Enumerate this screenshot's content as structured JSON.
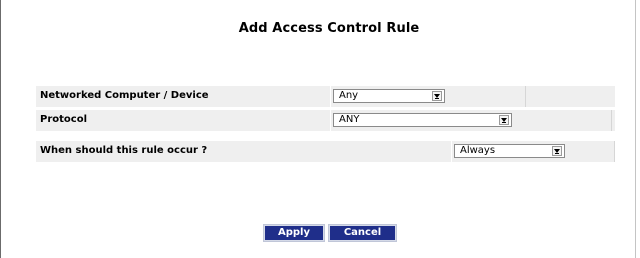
{
  "page": {
    "title": "Add Access Control Rule"
  },
  "rules": {
    "computer": {
      "label": "Networked Computer / Device",
      "value": "Any"
    },
    "protocol": {
      "label": "Protocol",
      "value": "ANY"
    },
    "schedule": {
      "label": "When should this rule occur ?",
      "value": "Always"
    }
  },
  "actions": {
    "apply_label": "Apply",
    "cancel_label": "Cancel"
  },
  "colors": {
    "button_bg": "#1f2e8a",
    "row_bg": "#efefef"
  },
  "icons": {
    "dropdown": "chevron-down-icon"
  }
}
